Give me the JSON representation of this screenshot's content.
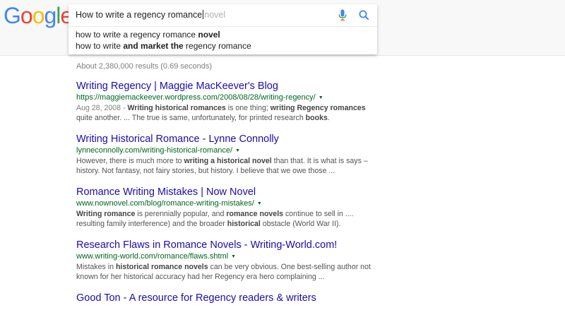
{
  "logo": {
    "letters": [
      "G",
      "o",
      "o",
      "g",
      "l",
      "e"
    ],
    "colors": [
      "#4285F4",
      "#EA4335",
      "#FBBC05",
      "#4285F4",
      "#34A853",
      "#EA4335"
    ]
  },
  "search": {
    "query": "How to write a regency romance",
    "ghost_completion": "novel",
    "mic_icon": "microphone-icon",
    "search_icon": "magnifier-icon",
    "suggestions": [
      {
        "prefix": "how to write a regency romance ",
        "bold": "novel",
        "suffix": ""
      },
      {
        "prefix": "how to write ",
        "bold": "and market the",
        "suffix": " regency romance"
      }
    ]
  },
  "stats": "About 2,380,000 results (0.69 seconds)",
  "results": [
    {
      "title": "Writing Regency | Maggie MacKeever's Blog",
      "url": "https://maggiemackeever.wordpress.com/2008/08/28/writing-regency/",
      "snippet": [
        {
          "t": "Aug 28, 2008 - ",
          "s": "date"
        },
        {
          "t": "Writing historical romances",
          "s": "b"
        },
        {
          "t": " is one thing; ",
          "s": ""
        },
        {
          "t": "writing Regency romances",
          "s": "b"
        },
        {
          "t": " quite another. ... The true is same, unfortunately, for printed research ",
          "s": ""
        },
        {
          "t": "books",
          "s": "b"
        },
        {
          "t": ".",
          "s": ""
        }
      ]
    },
    {
      "title": "Writing Historical Romance - Lynne Connolly",
      "url": "lynneconnolly.com/writing-historical-romance/",
      "snippet": [
        {
          "t": "However, there is much more to ",
          "s": ""
        },
        {
          "t": "writing a historical novel",
          "s": "b"
        },
        {
          "t": " than that. It is what is says – history. Not fantasy, not fairy stories, but history. I believe that we owe those ...",
          "s": ""
        }
      ]
    },
    {
      "title": "Romance Writing Mistakes | Now Novel",
      "url": "www.nownovel.com/blog/romance-writing-mistakes/",
      "snippet": [
        {
          "t": "Writing romance",
          "s": "b"
        },
        {
          "t": " is perennially popular, and ",
          "s": ""
        },
        {
          "t": "romance novels",
          "s": "b"
        },
        {
          "t": " continue to sell in .... resulting family interference) and the broader ",
          "s": ""
        },
        {
          "t": "historical",
          "s": "b"
        },
        {
          "t": " obstacle (World War II).",
          "s": ""
        }
      ]
    },
    {
      "title": "Research Flaws in Romance Novels - Writing-World.com!",
      "url": "www.writing-world.com/romance/flaws.shtml",
      "snippet": [
        {
          "t": "Mistakes in ",
          "s": ""
        },
        {
          "t": "historical romance novels",
          "s": "b"
        },
        {
          "t": " can be very obvious. One best-selling author not known for her historical accuracy had her Regency era hero complaining ...",
          "s": ""
        }
      ]
    },
    {
      "title": "Good Ton - A resource for Regency readers & writers",
      "url": "",
      "snippet": []
    }
  ]
}
